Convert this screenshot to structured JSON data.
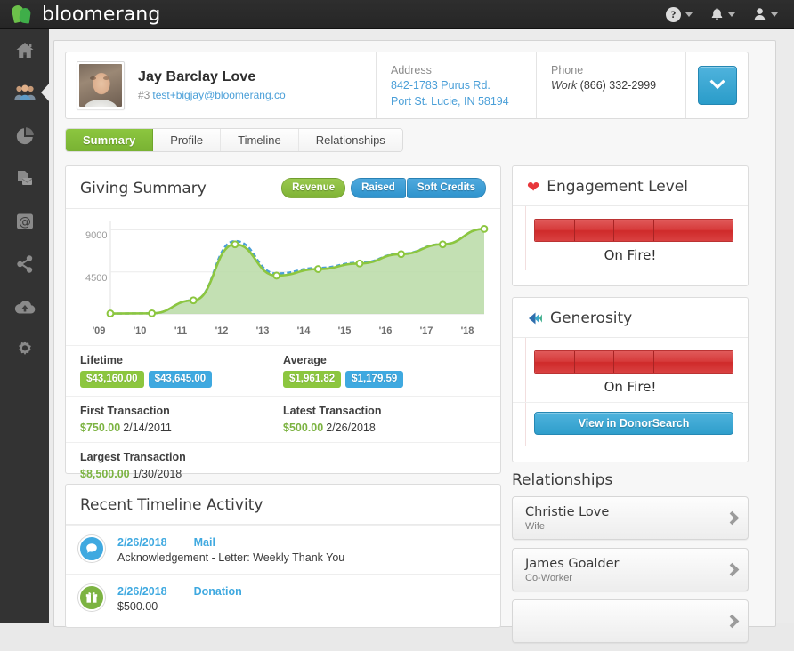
{
  "brand": {
    "name": "bloomerang"
  },
  "topbar": {
    "help_icon": "help-icon",
    "help_label": "?",
    "bell_icon": "bell-icon",
    "user_icon": "user-icon"
  },
  "sidebar": {
    "items": [
      {
        "name": "home",
        "icon": "home-icon",
        "active": false
      },
      {
        "name": "constituents",
        "icon": "people-icon",
        "active": true
      },
      {
        "name": "reports",
        "icon": "pie-chart-icon",
        "active": false
      },
      {
        "name": "letters",
        "icon": "documents-mail-icon",
        "active": false
      },
      {
        "name": "email",
        "icon": "at-sign-icon",
        "active": false
      },
      {
        "name": "social",
        "icon": "share-icon",
        "active": false
      },
      {
        "name": "import",
        "icon": "cloud-upload-icon",
        "active": false
      },
      {
        "name": "settings",
        "icon": "gear-icon",
        "active": false
      }
    ]
  },
  "contact": {
    "name": "Jay Barclay Love",
    "id": "#3",
    "email": "test+bigjay@bloomerang.co",
    "address_label": "Address",
    "address_line1": "842-1783 Purus Rd.",
    "address_line2": "Port St. Lucie, IN 58194",
    "phone_label": "Phone",
    "phone_type": "Work",
    "phone_number": "(866) 332-2999",
    "expand_icon": "chevron-down-icon"
  },
  "tabs": [
    {
      "label": "Summary",
      "active": true
    },
    {
      "label": "Profile",
      "active": false
    },
    {
      "label": "Timeline",
      "active": false
    },
    {
      "label": "Relationships",
      "active": false
    }
  ],
  "giving": {
    "title": "Giving Summary",
    "toggles": [
      {
        "label": "Revenue",
        "style": "green",
        "selected": true
      },
      {
        "label": "Raised",
        "style": "blue",
        "selected": false
      },
      {
        "label": "Soft Credits",
        "style": "blue",
        "selected": false
      }
    ],
    "stats": {
      "lifetime_label": "Lifetime",
      "lifetime_revenue": "$43,160.00",
      "lifetime_raised": "$43,645.00",
      "average_label": "Average",
      "average_revenue": "$1,961.82",
      "average_raised": "$1,179.59",
      "first_label": "First Transaction",
      "first_amount": "$750.00",
      "first_date": "2/14/2011",
      "latest_label": "Latest Transaction",
      "latest_amount": "$500.00",
      "latest_date": "2/26/2018",
      "largest_label": "Largest Transaction",
      "largest_amount": "$8,500.00",
      "largest_date": "1/30/2018"
    }
  },
  "chart_data": {
    "type": "area",
    "title": "Giving Summary",
    "xlabel": "",
    "ylabel": "",
    "categories": [
      "'09",
      "'10",
      "'11",
      "'12",
      "'13",
      "'14",
      "'15",
      "'16",
      "'17",
      "'18"
    ],
    "ylim": [
      0,
      9900
    ],
    "yticks": [
      4500,
      9000
    ],
    "grid": true,
    "legend": "hidden",
    "series": [
      {
        "name": "Revenue",
        "color": "#8cc63f",
        "fill": "#b9dba6",
        "style": "solid-area",
        "values": [
          40,
          60,
          1450,
          7450,
          4100,
          4800,
          5400,
          6400,
          7450,
          9100
        ]
      },
      {
        "name": "Raised",
        "color": "#4a9fd8",
        "style": "dashed-line",
        "values": [
          40,
          60,
          1450,
          7800,
          4330,
          4930,
          5480,
          6450,
          7470,
          9100
        ]
      }
    ]
  },
  "timeline": {
    "title": "Recent Timeline Activity",
    "items": [
      {
        "icon": "speech-bubble-icon",
        "icon_color": "blue",
        "date": "2/26/2018",
        "type": "Mail",
        "description": "Acknowledgement - Letter: Weekly Thank You"
      },
      {
        "icon": "gift-icon",
        "icon_color": "green",
        "date": "2/26/2018",
        "type": "Donation",
        "description": "$500.00"
      }
    ]
  },
  "engagement": {
    "title": "Engagement Level",
    "icon": "heart-icon",
    "level_label": "On Fire!",
    "segments": 5,
    "filled": 5,
    "color": "#d63a3a"
  },
  "generosity": {
    "title": "Generosity",
    "icon": "donorsearch-logo-icon",
    "level_label": "On Fire!",
    "segments": 5,
    "filled": 5,
    "color": "#d63a3a",
    "button_label": "View in DonorSearch"
  },
  "relationships": {
    "title": "Relationships",
    "items": [
      {
        "name": "Christie Love",
        "role": "Wife"
      },
      {
        "name": "James Goalder",
        "role": "Co-Worker"
      },
      {
        "name": "",
        "role": ""
      }
    ]
  }
}
